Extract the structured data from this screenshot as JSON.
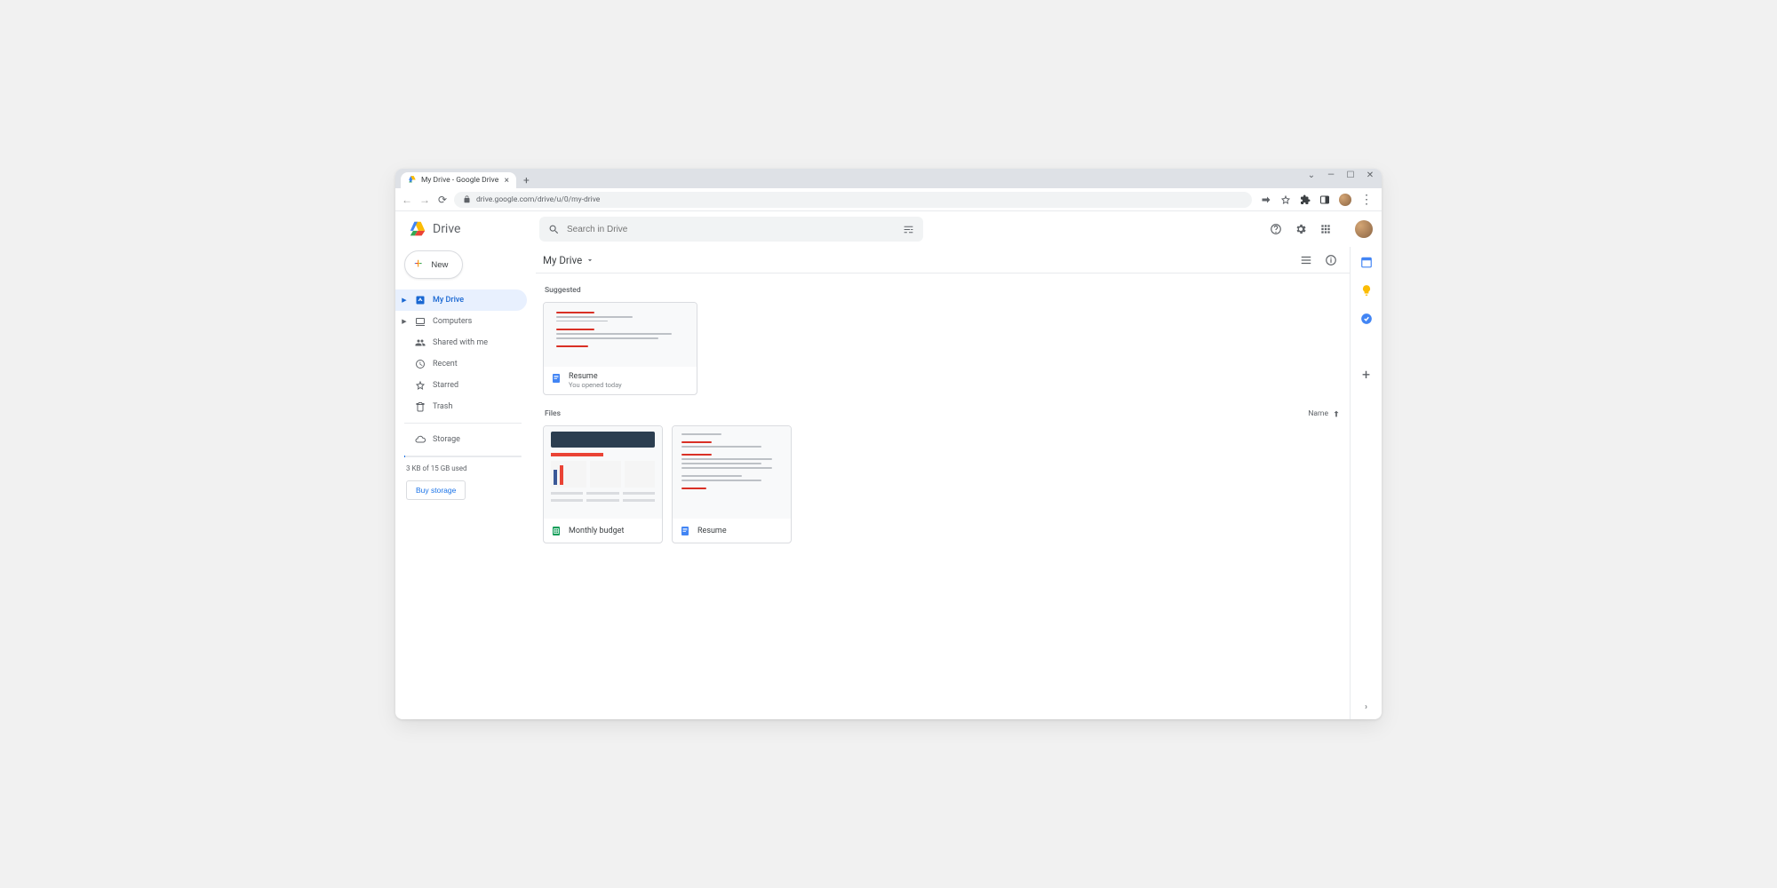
{
  "browser": {
    "tab_title": "My Drive - Google Drive",
    "url": "drive.google.com/drive/u/0/my-drive"
  },
  "app": {
    "logo_text": "Drive",
    "search_placeholder": "Search in Drive"
  },
  "sidebar": {
    "new_label": "New",
    "items": [
      {
        "label": "My Drive",
        "selected": true,
        "expandable": true
      },
      {
        "label": "Computers",
        "selected": false,
        "expandable": true
      },
      {
        "label": "Shared with me",
        "selected": false,
        "expandable": false
      },
      {
        "label": "Recent",
        "selected": false,
        "expandable": false
      },
      {
        "label": "Starred",
        "selected": false,
        "expandable": false
      },
      {
        "label": "Trash",
        "selected": false,
        "expandable": false
      }
    ],
    "storage_label": "Storage",
    "storage_used": "3 KB of 15 GB used",
    "buy_label": "Buy storage"
  },
  "toolbar": {
    "breadcrumb": "My Drive"
  },
  "content": {
    "suggested_label": "Suggested",
    "suggested": [
      {
        "title": "Resume",
        "subtitle": "You opened today",
        "type": "doc"
      }
    ],
    "files_label": "Files",
    "sort_label": "Name",
    "files": [
      {
        "title": "Monthly budget",
        "type": "sheet"
      },
      {
        "title": "Resume",
        "type": "doc"
      }
    ]
  }
}
